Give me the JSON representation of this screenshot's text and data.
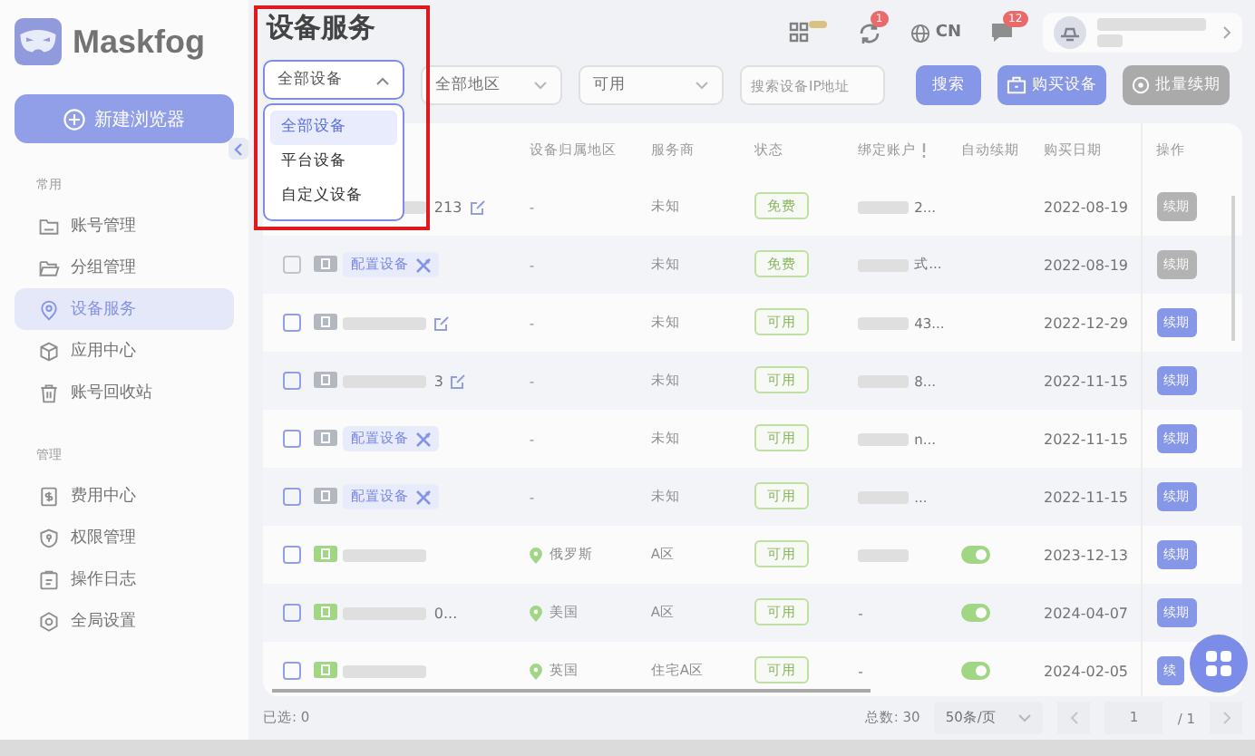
{
  "brand": "Maskfog",
  "new_button": "新建浏览器",
  "sidebar": [
    {
      "heading": "常用",
      "items": [
        {
          "label": "账号管理",
          "kind": "folder",
          "selected": false
        },
        {
          "label": "分组管理",
          "kind": "folder-open",
          "selected": false
        },
        {
          "label": "设备服务",
          "kind": "pin",
          "selected": true
        },
        {
          "label": "应用中心",
          "kind": "cube",
          "selected": false
        },
        {
          "label": "账号回收站",
          "kind": "trash",
          "selected": false
        }
      ]
    },
    {
      "heading": "管理",
      "items": [
        {
          "label": "费用中心",
          "kind": "bill",
          "selected": false
        },
        {
          "label": "权限管理",
          "kind": "shield",
          "selected": false
        },
        {
          "label": "操作日志",
          "kind": "clipboard",
          "selected": false
        },
        {
          "label": "全局设置",
          "kind": "gear",
          "selected": false
        }
      ]
    }
  ],
  "header": {
    "title": "设备服务",
    "sync_badge": "1",
    "language": "CN",
    "message_badge": "12"
  },
  "filters": {
    "device_type": {
      "value": "全部设备",
      "expanded": true,
      "options": [
        {
          "label": "全部设备",
          "selected": true
        },
        {
          "label": "平台设备",
          "selected": false
        },
        {
          "label": "自定义设备",
          "selected": false
        }
      ]
    },
    "region": {
      "value": "全部地区"
    },
    "status": {
      "value": "可用"
    },
    "search": {
      "placeholder": "搜索设备IP地址"
    },
    "search_button": "搜索",
    "buy_button": "购买设备",
    "renew_all_button": {
      "label": "批量续期",
      "disabled": true
    }
  },
  "table": {
    "columns": [
      "设备归属地区",
      "服务商",
      "状态",
      "绑定账户",
      "自动续期",
      "购买日期",
      "操作"
    ],
    "rows": [
      {
        "config": false,
        "name": "213",
        "editable": true,
        "region": "-",
        "pin": false,
        "service": "未知",
        "status": "免费",
        "account": "2...",
        "account_blurred": true,
        "date": "2022-08-19",
        "action": {
          "label": "续期",
          "disabled": true
        }
      },
      {
        "checked": false,
        "kind": "custom",
        "config": true,
        "name": "配置设备",
        "editable": false,
        "region": "-",
        "pin": false,
        "service": "未知",
        "status": "免费",
        "account": "式...",
        "account_blurred": true,
        "date": "2022-08-19",
        "action": {
          "label": "续期",
          "disabled": true
        }
      },
      {
        "checked": false,
        "kind": "custom",
        "config": false,
        "name": "",
        "editable": true,
        "region": "-",
        "pin": false,
        "service": "未知",
        "status": "可用",
        "account": "43...",
        "account_blurred": true,
        "date": "2022-12-29",
        "action": {
          "label": "续期",
          "disabled": false
        }
      },
      {
        "checked": false,
        "kind": "custom",
        "config": false,
        "name": "3",
        "editable": true,
        "region": "-",
        "pin": false,
        "service": "未知",
        "status": "可用",
        "account": "8...",
        "account_blurred": true,
        "date": "2022-11-15",
        "action": {
          "label": "续期",
          "disabled": false
        }
      },
      {
        "checked": false,
        "kind": "custom",
        "config": true,
        "name": "配置设备",
        "editable": false,
        "region": "-",
        "pin": false,
        "service": "未知",
        "status": "可用",
        "account": "n...",
        "account_blurred": true,
        "date": "2022-11-15",
        "action": {
          "label": "续期",
          "disabled": false
        }
      },
      {
        "checked": false,
        "kind": "custom",
        "config": true,
        "name": "配置设备",
        "editable": false,
        "region": "-",
        "pin": false,
        "service": "未知",
        "status": "可用",
        "account": "...",
        "account_blurred": true,
        "date": "2022-11-15",
        "action": {
          "label": "续期",
          "disabled": false
        }
      },
      {
        "checked": false,
        "kind": "platform",
        "config": false,
        "name": "",
        "editable": false,
        "region": "俄罗斯",
        "pin": true,
        "service": "A区",
        "status": "可用",
        "account": "",
        "account_blurred": true,
        "auto_renew": true,
        "date": "2023-12-13",
        "action": {
          "label": "续期",
          "disabled": false
        }
      },
      {
        "checked": false,
        "kind": "platform",
        "config": false,
        "name": "0...",
        "editable": false,
        "region": "美国",
        "pin": true,
        "service": "A区",
        "status": "可用",
        "account": "-",
        "account_blurred": false,
        "auto_renew": true,
        "date": "2024-04-07",
        "action": {
          "label": "续期",
          "disabled": false
        }
      },
      {
        "checked": false,
        "kind": "platform",
        "config": false,
        "name": "",
        "editable": false,
        "region": "英国",
        "pin": true,
        "service": "住宅A区",
        "status": "可用",
        "account": "-",
        "account_blurred": false,
        "auto_renew": true,
        "date": "2024-02-05",
        "action": {
          "label": "续",
          "disabled": false
        }
      }
    ]
  },
  "footer": {
    "selected": "已选: 0",
    "total": "总数: 30",
    "page_size": "50条/页",
    "page": "1",
    "pages": "/ 1"
  }
}
